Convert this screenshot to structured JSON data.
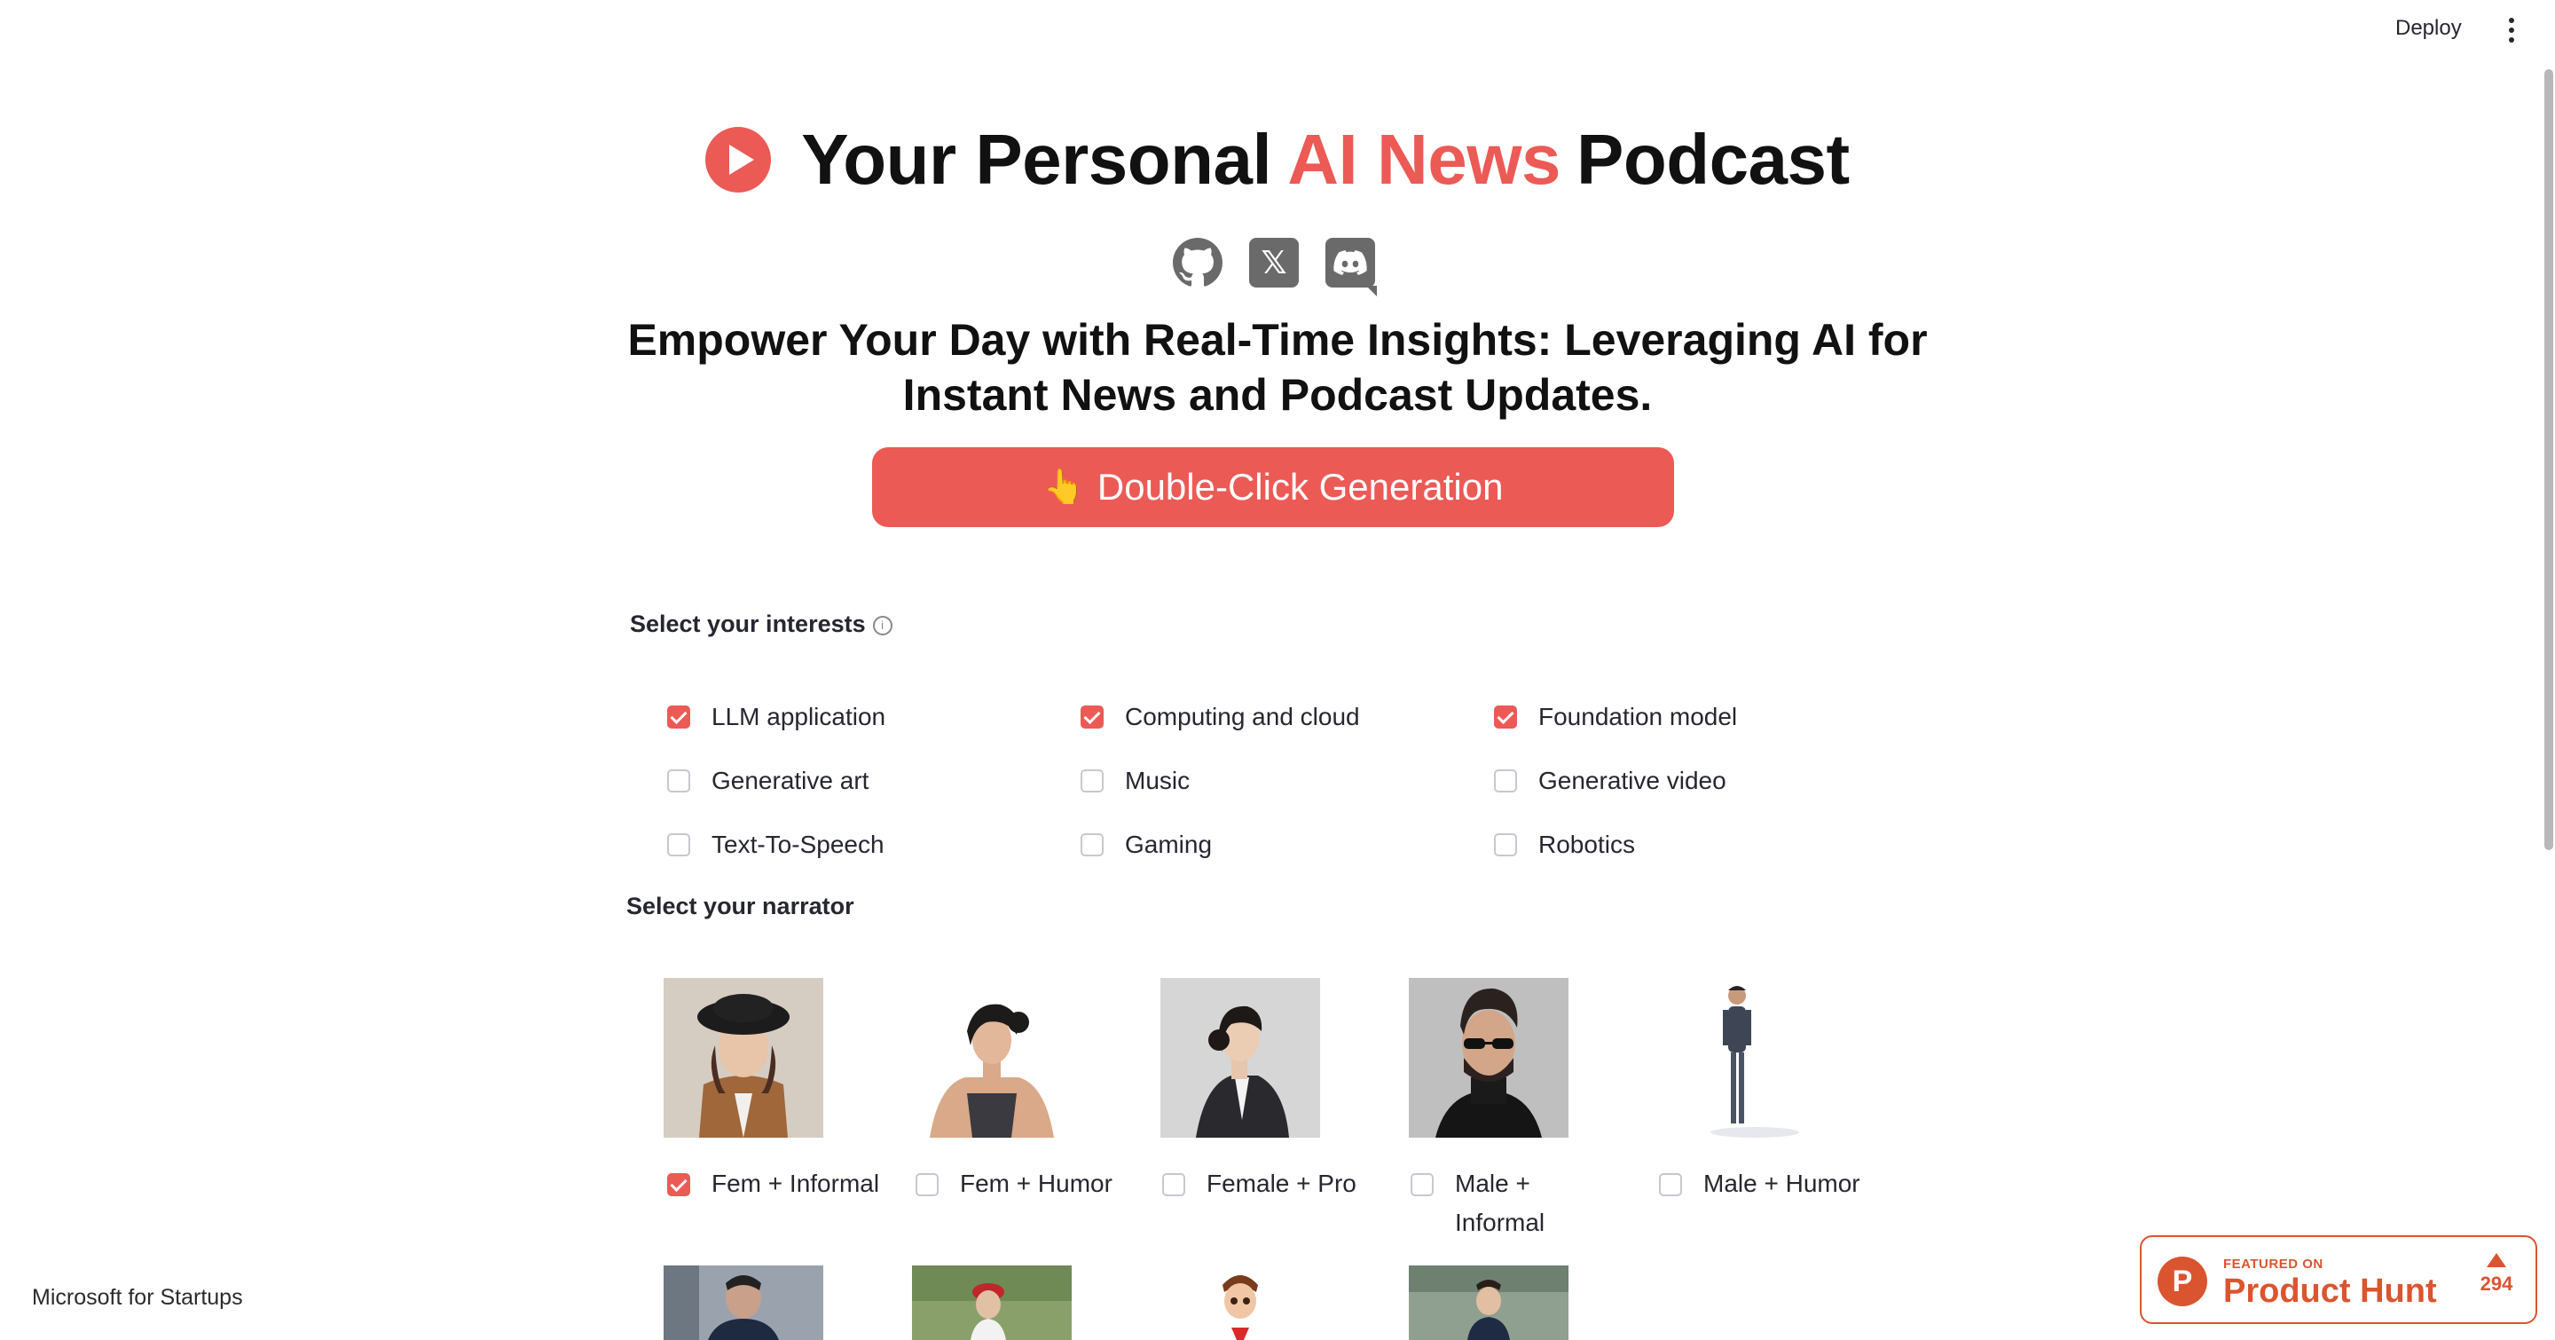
{
  "header": {
    "deploy_label": "Deploy",
    "menu_icon": "kebab-menu-icon"
  },
  "title": {
    "prefix": "Your Personal",
    "accent": "AI News",
    "suffix": "Podcast",
    "accent_color": "#ec5a55"
  },
  "socials": [
    {
      "icon": "github-icon"
    },
    {
      "icon": "x-twitter-icon",
      "glyph": "𝕏"
    },
    {
      "icon": "discord-icon"
    }
  ],
  "subtitle": "Empower Your Day with Real-Time Insights: Leveraging AI for Instant News and Podcast Updates.",
  "generate_button": {
    "icon": "👆",
    "label": "Double-Click Generation",
    "color": "#ec5a55"
  },
  "interests": {
    "label": "Select your interests",
    "info_icon": "ⓘ",
    "options": [
      {
        "label": "LLM application",
        "checked": true
      },
      {
        "label": "Computing and cloud",
        "checked": true
      },
      {
        "label": "Foundation model",
        "checked": true
      },
      {
        "label": "Generative art",
        "checked": false
      },
      {
        "label": "Music",
        "checked": false
      },
      {
        "label": "Generative video",
        "checked": false
      },
      {
        "label": "Text-To-Speech",
        "checked": false
      },
      {
        "label": "Gaming",
        "checked": false
      },
      {
        "label": "Robotics",
        "checked": false
      }
    ]
  },
  "narrator": {
    "label": "Select your narrator",
    "options": [
      {
        "label": "Fem + Informal",
        "checked": true
      },
      {
        "label": "Fem + Humor",
        "checked": false
      },
      {
        "label": "Female + Pro",
        "checked": false
      },
      {
        "label": "Male +\nInformal",
        "checked": false
      },
      {
        "label": "Male + Humor",
        "checked": false
      }
    ]
  },
  "footer": {
    "microsoft": "Microsoft for Startups",
    "product_hunt": {
      "featured": "FEATURED ON",
      "name": "Product Hunt",
      "logo": "P",
      "votes": "294"
    }
  }
}
